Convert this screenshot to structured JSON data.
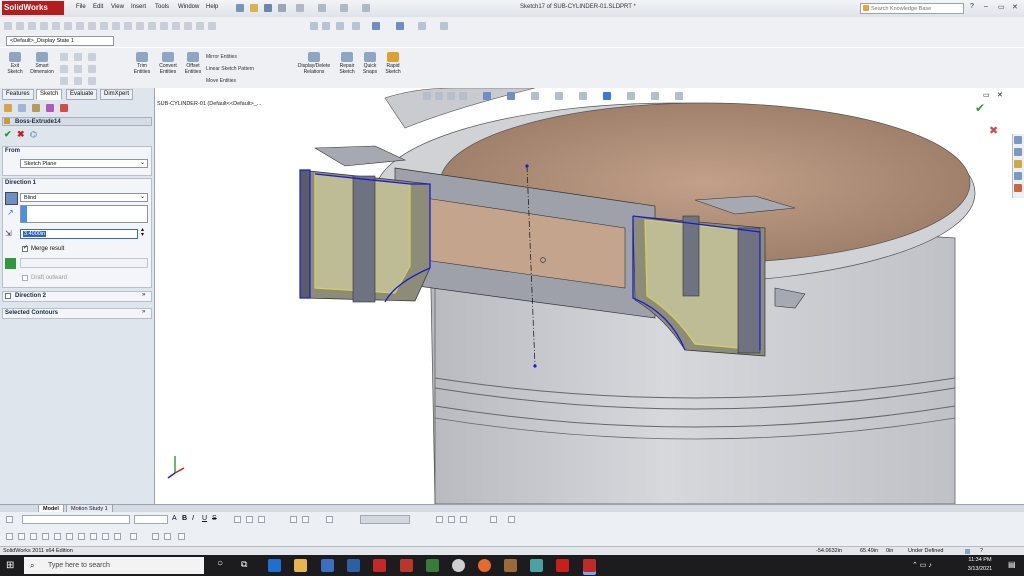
{
  "app": {
    "logo_text": "SolidWorks",
    "menu": [
      "File",
      "Edit",
      "View",
      "Insert",
      "Tools",
      "Window",
      "Help"
    ],
    "document_title": "Sketch17 of SUB-CYLINDER-01.SLDPRT *",
    "search_placeholder": "Search Knowledge Base",
    "help_label": "?",
    "window_controls": [
      "–",
      "▭",
      "✕"
    ]
  },
  "config_dropdown": "<Default>_Display State 1",
  "command_manager": {
    "items": [
      {
        "label": "Exit Sketch",
        "icon": "exit-sketch-icon"
      },
      {
        "label": "Smart Dimension",
        "icon": "smart-dimension-icon"
      },
      {
        "label": "Trim Entities",
        "icon": "trim-icon"
      },
      {
        "label": "Convert Entities",
        "icon": "convert-icon"
      },
      {
        "label": "Offset Entities",
        "icon": "offset-icon"
      },
      {
        "label": "Display/Delete Relations",
        "icon": "relations-icon"
      },
      {
        "label": "Repair Sketch",
        "icon": "repair-icon"
      },
      {
        "label": "Quick Snaps",
        "icon": "snap-icon"
      },
      {
        "label": "Rapid Sketch",
        "icon": "rapid-sketch-icon"
      }
    ],
    "pattern_items": [
      "Mirror Entities",
      "Linear Sketch Pattern",
      "Move Entities"
    ]
  },
  "panel_tabs": [
    "Features",
    "Sketch",
    "Evaluate",
    "DimXpert"
  ],
  "property_manager": {
    "feature_title": "Boss-Extrude14",
    "from": {
      "header": "From",
      "value": "Sketch Plane"
    },
    "direction1": {
      "header": "Direction 1",
      "end_condition": "Blind",
      "depth": "3.4000in",
      "merge_label": "Merge result",
      "draft_label": "Draft outward"
    },
    "direction2": {
      "header": "Direction 2"
    },
    "selected_contours": {
      "header": "Selected Contours"
    }
  },
  "feature_tree_label": "SUB-CYLINDER-01  (Default<<Default>_...",
  "bottom_tabs": [
    "Model",
    "Motion Study 1"
  ],
  "status": {
    "left": "SolidWorks 2011 x64 Edition",
    "x": "-54.0632in",
    "y": "65.49in",
    "z": "0in",
    "state": "Under Defined"
  },
  "taskbar": {
    "search_placeholder": "Type here to search",
    "time": "11:34 PM",
    "date": "3/13/2021"
  },
  "colors": {
    "accent": "#1f4e9b",
    "logo": "#b51d1d",
    "sketch_blue": "#1a1adc",
    "preview_yellow": "#e2dc5a",
    "model_gray": "#c7c9ce"
  }
}
